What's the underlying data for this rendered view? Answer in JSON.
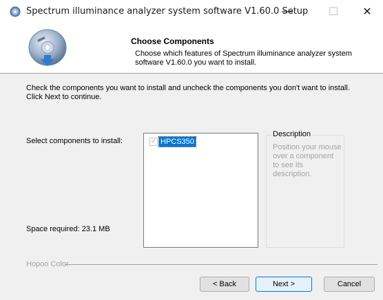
{
  "window": {
    "title": "Spectrum illuminance analyzer system software V1.60.0 Setup",
    "controls": {
      "minimize": "—",
      "maximize": "☐",
      "close": "✕"
    }
  },
  "header": {
    "title": "Choose Components",
    "description": "Choose which features of Spectrum illuminance analyzer system software V1.60.0 you want to install."
  },
  "body": {
    "intro": "Check the components you want to install and uncheck the components you don't want to install. Click Next to continue.",
    "select_label": "Select components to install:",
    "space_required": "Space required: 23.1 MB",
    "components": [
      {
        "label": "HPCS350",
        "checked": true,
        "disabled": true,
        "selected": true
      }
    ],
    "description_group": {
      "title": "Description",
      "text": "Position your mouse over a component to see its description."
    }
  },
  "brand": "Hopoo Color",
  "buttons": {
    "back": "< Back",
    "next": "Next >",
    "cancel": "Cancel"
  },
  "colors": {
    "selection": "#0078d7",
    "window_bg": "#f0f0f0",
    "header_bg": "#ffffff",
    "disabled_text": "#a3a3a3"
  },
  "icons": {
    "app": "installer-disc-icon",
    "header": "installer-disc-download-icon"
  }
}
